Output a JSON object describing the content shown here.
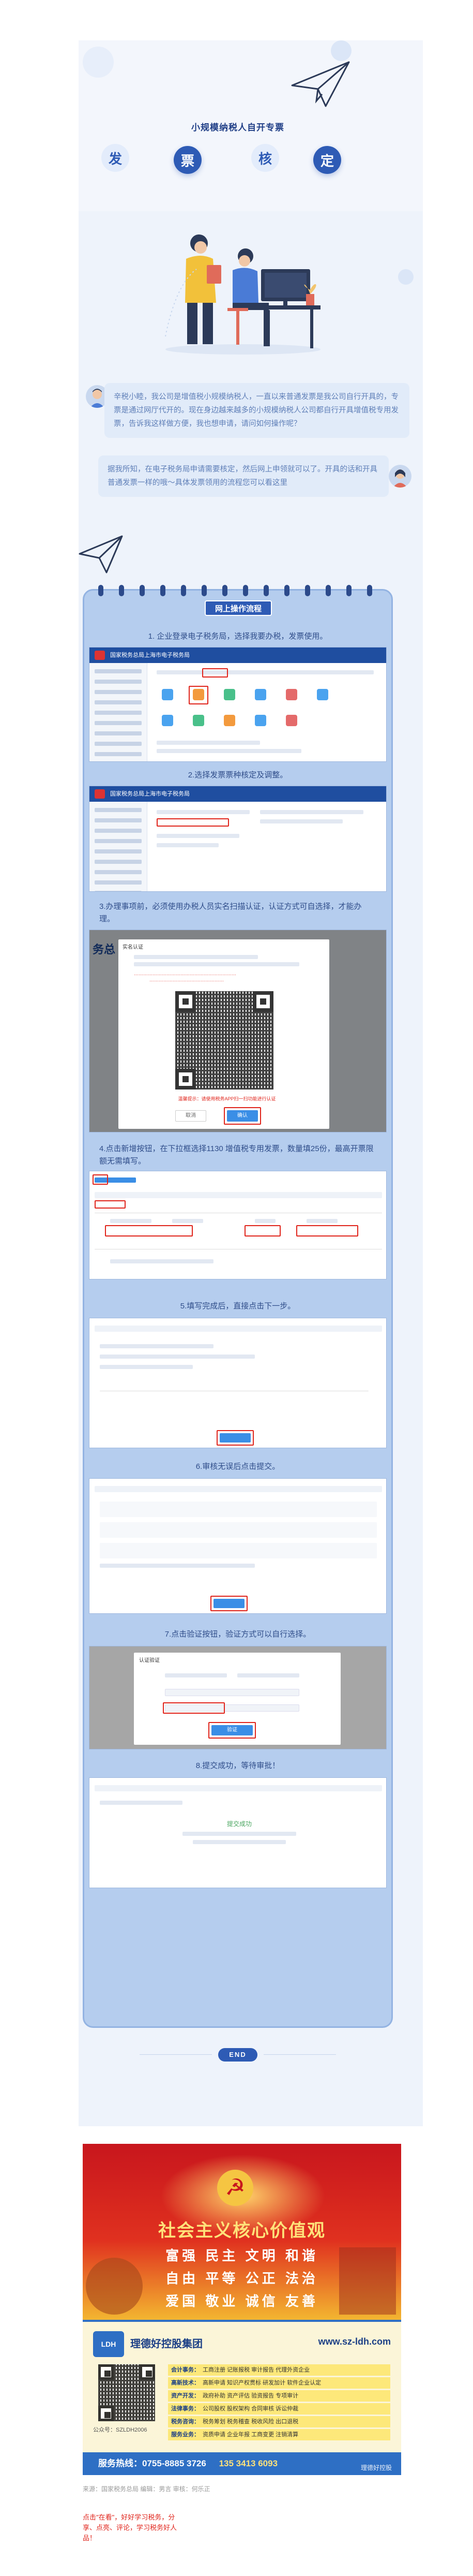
{
  "header": {
    "title": "小规模纳税人自开专票",
    "chars": [
      "发",
      "票",
      "核",
      "定"
    ]
  },
  "chat": {
    "question": "辛税小睦，我公司是增值税小规模纳税人，一直以来普通发票是我公司自行开具的，专票是通过网厅代开的。现在身边越来越多的小规模纳税人公司都自行开具增值税专用发票，告诉我这样做方便，我也想申请，请问如何操作呢？",
    "answer": "据我所知，在电子税务局申请需要核定，然后网上申领就可以了。开具的话和开具普通发票一样的哦～具体发票领用的流程您可以看这里"
  },
  "process": {
    "title": "网上操作流程",
    "steps": [
      "1. 企业登录电子税务局，选择我要办税，发票使用。",
      "2.选择发票票种核定及调整。",
      "3.办理事项前，必须使用办税人员实名扫描认证，认证方式可自选择，才能办理。",
      "4.点击新增按钮，在下拉框选择1130 增值税专用发票，数量填25份，最高开票限额无需填写。",
      "5.填写完成后，直接点击下一步。",
      "6.审核无误后点击提交。",
      "7.点击验证按钮，验证方式可以自行选择。",
      "8.提交成功，等待审批！"
    ]
  },
  "screens": {
    "bar1": "国家税务总局上海市电子税务局",
    "bar2": "国家税务总局上海市电子税务局",
    "bar3": "务总",
    "scan_title": "实名认证",
    "scan_tip": "温馨提示：请使用税务APP扫一扫功能进行认证",
    "confirm": "确认",
    "cancel": "取消",
    "verify_title": "认证验证",
    "verify_btn": "验证",
    "success_text": "提交成功"
  },
  "end": {
    "label": "END"
  },
  "banner": {
    "heading": "社会主义核心价值观",
    "rows": [
      "富强  民主  文明  和谐",
      "自由  平等  公正  法治",
      "爱国  敬业  诚信  友善"
    ]
  },
  "company": {
    "logo": "LDH",
    "name": "理德好控股集团",
    "site": "www.sz-ldh.com",
    "wechat": "公众号：SZLDH2006",
    "services": [
      {
        "k": "会计事务：",
        "v": "工商注册  记账报税  审计报告  代理外资企业"
      },
      {
        "k": "高新技术：",
        "v": "高新申请  知识产权贯标  研发加计  软件企业认定"
      },
      {
        "k": "资产开发：",
        "v": "政府补助  资产评估  验资报告  专项审计"
      },
      {
        "k": "法律事务：",
        "v": "公司股权  股权架构  合同审核  诉讼仲裁"
      },
      {
        "k": "税务咨询：",
        "v": "税务筹划  税务稽查  税收风险  出口退税"
      },
      {
        "k": "服务业务：",
        "v": "资质申请  企业年报  工商变更  注销清算"
      }
    ],
    "hotline_label": "服务热线：0755-8885 3726",
    "hotline_mobile": "135 3413 6093",
    "watermark": "理德好控股"
  },
  "footer": {
    "source": "来源：国家税务总局   编辑：男言   审核：何乐正",
    "cta": "点击\"在看\"，好好学习税务，分享、点亮、评论，学习税务好人品！"
  },
  "colors": {
    "accent": "#2e5bb5",
    "panel": "#b5cdee",
    "highlight": "#e0241b",
    "background": "#eef3fb"
  }
}
